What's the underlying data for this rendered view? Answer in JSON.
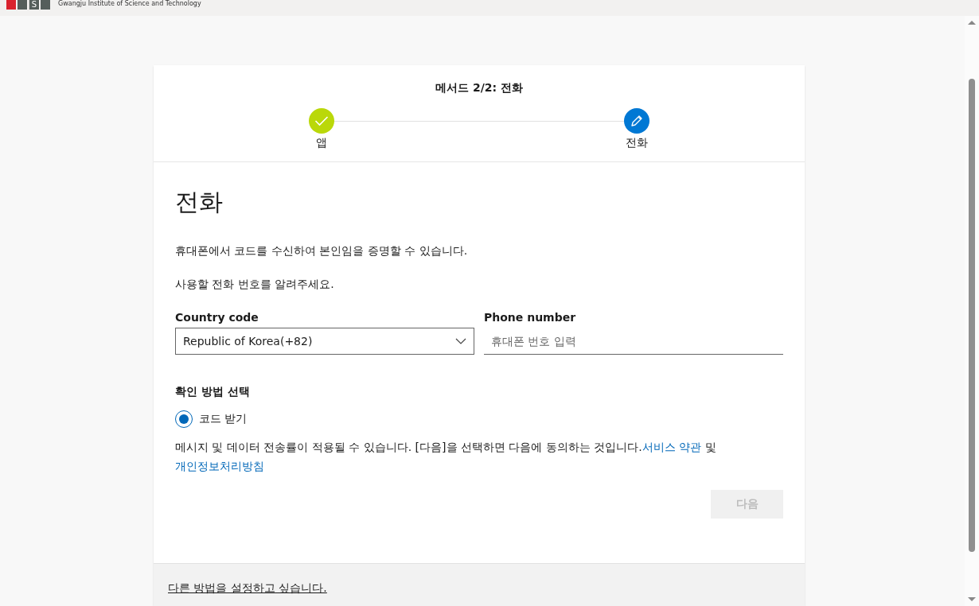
{
  "top_bar": {
    "logo_letter": "S",
    "institution": "Gwangju Institute of Science and Technology"
  },
  "progress": {
    "title": "메서드 2/2: 전화",
    "steps": [
      {
        "label": "앱",
        "completed": true
      },
      {
        "label": "전화",
        "completed": false
      }
    ]
  },
  "heading": "전화",
  "paragraphs": [
    "휴대폰에서 코드를 수신하여 본인임을 증명할 수 있습니다.",
    "사용할 전화 번호를 알려주세요."
  ],
  "country_code": {
    "label": "Country code",
    "value": "Republic of Korea(+82)"
  },
  "phone_number": {
    "label": "Phone number",
    "placeholder": "휴대폰 번호 입력"
  },
  "method": {
    "label": "확인 방법 선택",
    "options": [
      {
        "label": "코드 받기",
        "selected": true
      }
    ]
  },
  "consent": [
    {
      "kind": "text",
      "text": "메시지 및 데이터 전송률이 적용될 수 있습니다. [다음]을 선택하면 다음에 동의하는 것입니다."
    },
    {
      "kind": "link",
      "text": "서비스 약관"
    },
    {
      "kind": "text",
      "text": " 및 "
    },
    {
      "kind": "link",
      "text": "개인정보처리방침"
    }
  ],
  "next_button": {
    "label": "다음",
    "disabled": true
  },
  "footer_link": "다른 방법을 설정하고 싶습니다."
}
